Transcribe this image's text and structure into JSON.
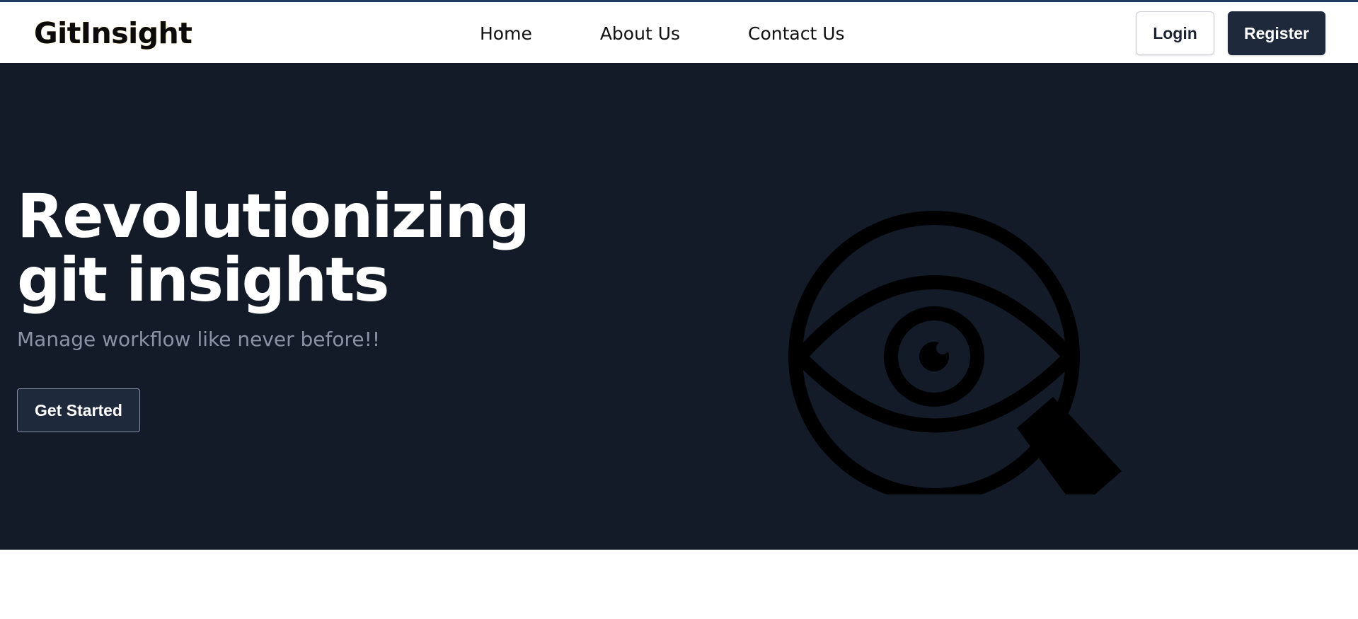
{
  "brand": {
    "logo_text": "GitInsight"
  },
  "nav": {
    "links": [
      "Home",
      "About Us",
      "Contact Us"
    ]
  },
  "auth": {
    "login_label": "Login",
    "register_label": "Register"
  },
  "hero": {
    "title": "Revolutionizing git insights",
    "subtitle": "Manage workflow like never before!!",
    "cta_label": "Get Started",
    "illustration_icon": "magnifying-glass-eye-icon"
  },
  "colors": {
    "hero_background": "#131a28",
    "primary_button": "#1e293b",
    "subtitle_text": "#8a94a6"
  }
}
